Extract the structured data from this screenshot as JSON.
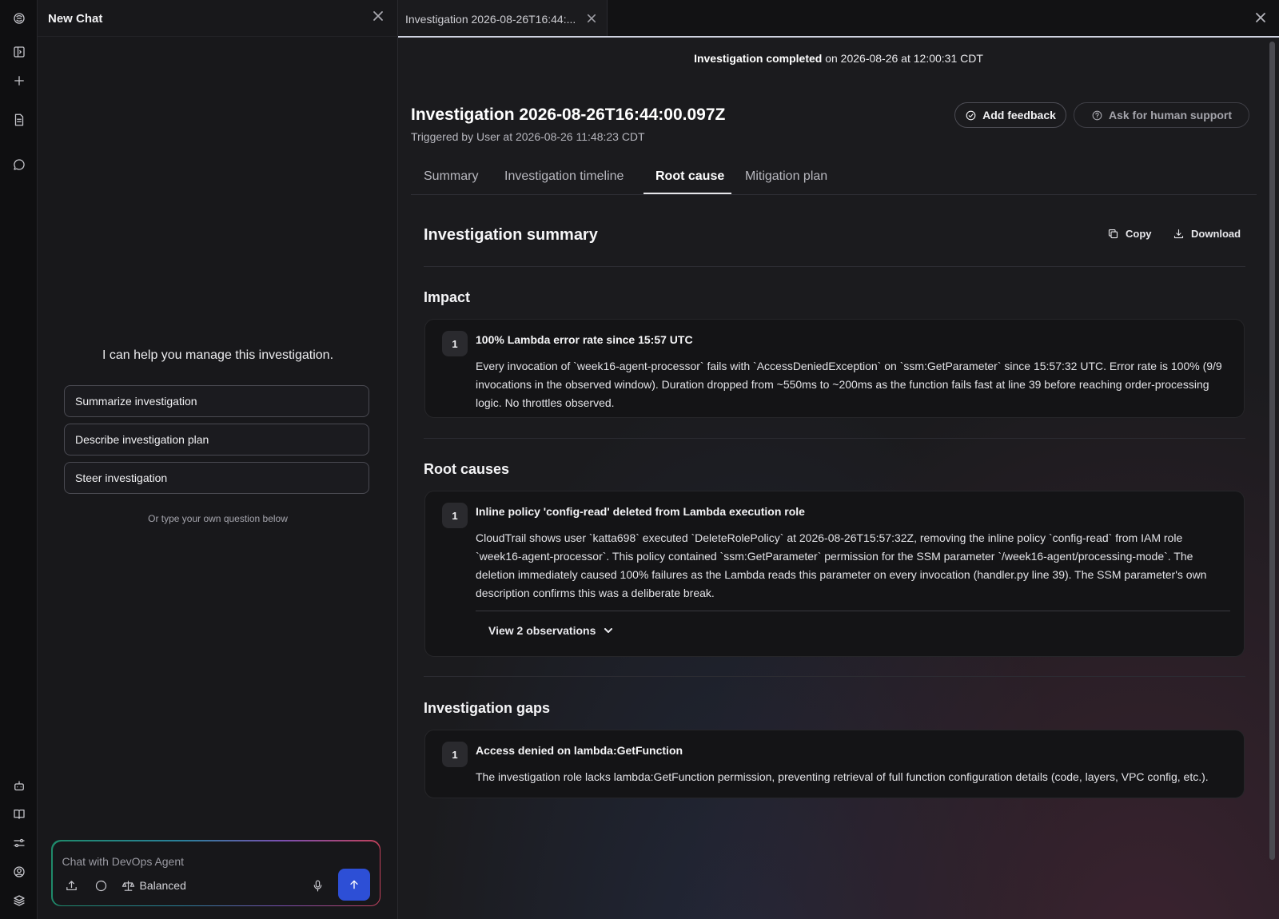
{
  "chat": {
    "title": "New Chat",
    "intro": "I can help you manage this investigation.",
    "suggestions": [
      "Summarize investigation",
      "Describe investigation plan",
      "Steer investigation"
    ],
    "hint": "Or type your own question below",
    "composer": {
      "placeholder": "Chat with DevOps Agent",
      "mode": "Balanced"
    }
  },
  "main": {
    "tab_label": "Investigation 2026-08-26T16:44:...",
    "status": {
      "bold": "Investigation completed",
      "rest": " on 2026-08-26 at 12:00:31 CDT"
    },
    "title": "Investigation 2026-08-26T16:44:00.097Z",
    "subtitle": "Triggered by User at 2026-08-26 11:48:23 CDT",
    "buttons": {
      "feedback": "Add feedback",
      "support": "Ask for human support"
    },
    "tabs": [
      {
        "label": "Summary",
        "active": false
      },
      {
        "label": "Investigation timeline",
        "active": false
      },
      {
        "label": "Root cause",
        "active": true
      },
      {
        "label": "Mitigation plan",
        "active": false
      }
    ],
    "section_title": "Investigation summary",
    "actions": {
      "copy": "Copy",
      "download": "Download"
    },
    "impact": {
      "heading": "Impact",
      "items": [
        {
          "num": "1",
          "title": "100% Lambda error rate since 15:57 UTC",
          "body": "Every invocation of `week16-agent-processor` fails with `AccessDeniedException` on `ssm:GetParameter` since 15:57:32 UTC. Error rate is 100% (9/9 invocations in the observed window). Duration dropped from ~550ms to ~200ms as the function fails fast at line 39 before reaching order-processing logic. No throttles observed."
        }
      ]
    },
    "root_causes": {
      "heading": "Root causes",
      "items": [
        {
          "num": "1",
          "title": "Inline policy 'config-read' deleted from Lambda execution role",
          "body": "CloudTrail shows user `katta698` executed `DeleteRolePolicy` at 2026-08-26T15:57:32Z, removing the inline policy `config-read` from IAM role `week16-agent-processor`. This policy contained `ssm:GetParameter` permission for the SSM parameter `/week16-agent/processing-mode`. The deletion immediately caused 100% failures as the Lambda reads this parameter on every invocation (handler.py line 39). The SSM parameter's own description confirms this was a deliberate break.",
          "observations": "View 2 observations"
        }
      ]
    },
    "gaps": {
      "heading": "Investigation gaps",
      "items": [
        {
          "num": "1",
          "title": "Access denied on lambda:GetFunction",
          "body": "The investigation role lacks lambda:GetFunction permission, preventing retrieval of full function configuration details (code, layers, VPC config, etc.)."
        }
      ]
    }
  },
  "icons": {
    "rail": [
      "logo-icon",
      "sidebar-toggle-icon",
      "plus-icon",
      "document-icon",
      "chat-icon",
      "bot-icon",
      "book-icon",
      "sliders-icon",
      "user-circle-icon",
      "layers-icon"
    ]
  },
  "colors": {
    "send_button": "#2d4fd6",
    "background": "#1b1b1e"
  }
}
